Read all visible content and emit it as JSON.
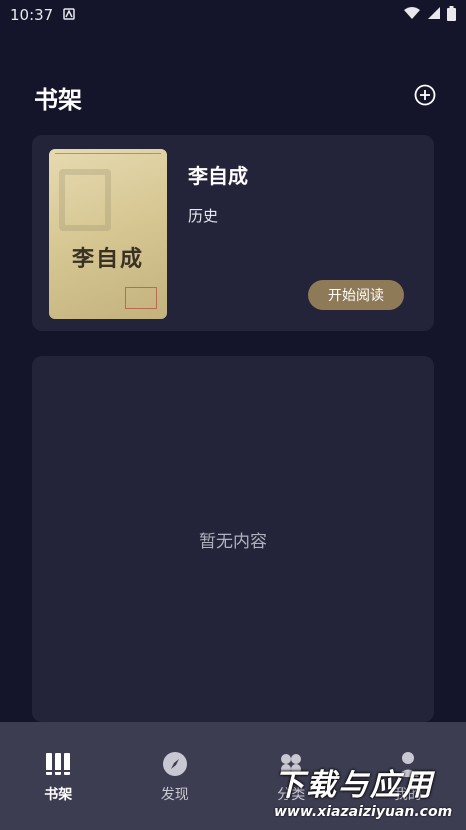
{
  "status_bar": {
    "time": "10:37"
  },
  "header": {
    "title": "书架"
  },
  "book": {
    "title": "李自成",
    "category": "历史",
    "cover_title": "李自成",
    "read_button": "开始阅读"
  },
  "empty_state": {
    "text": "暂无内容"
  },
  "bottom_nav": {
    "items": [
      {
        "label": "书架",
        "icon": "books-icon",
        "active": true
      },
      {
        "label": "发现",
        "icon": "compass-icon",
        "active": false
      },
      {
        "label": "分类",
        "icon": "grid-icon",
        "active": false
      },
      {
        "label": "我的",
        "icon": "person-icon",
        "active": false
      }
    ]
  },
  "watermark": {
    "title": "下载与应用",
    "url": "www.xiazaiziyuan.com"
  },
  "colors": {
    "background": "#14142a",
    "card": "#23233a",
    "nav": "#3d3d52",
    "accent_button": "#8f7a57"
  }
}
